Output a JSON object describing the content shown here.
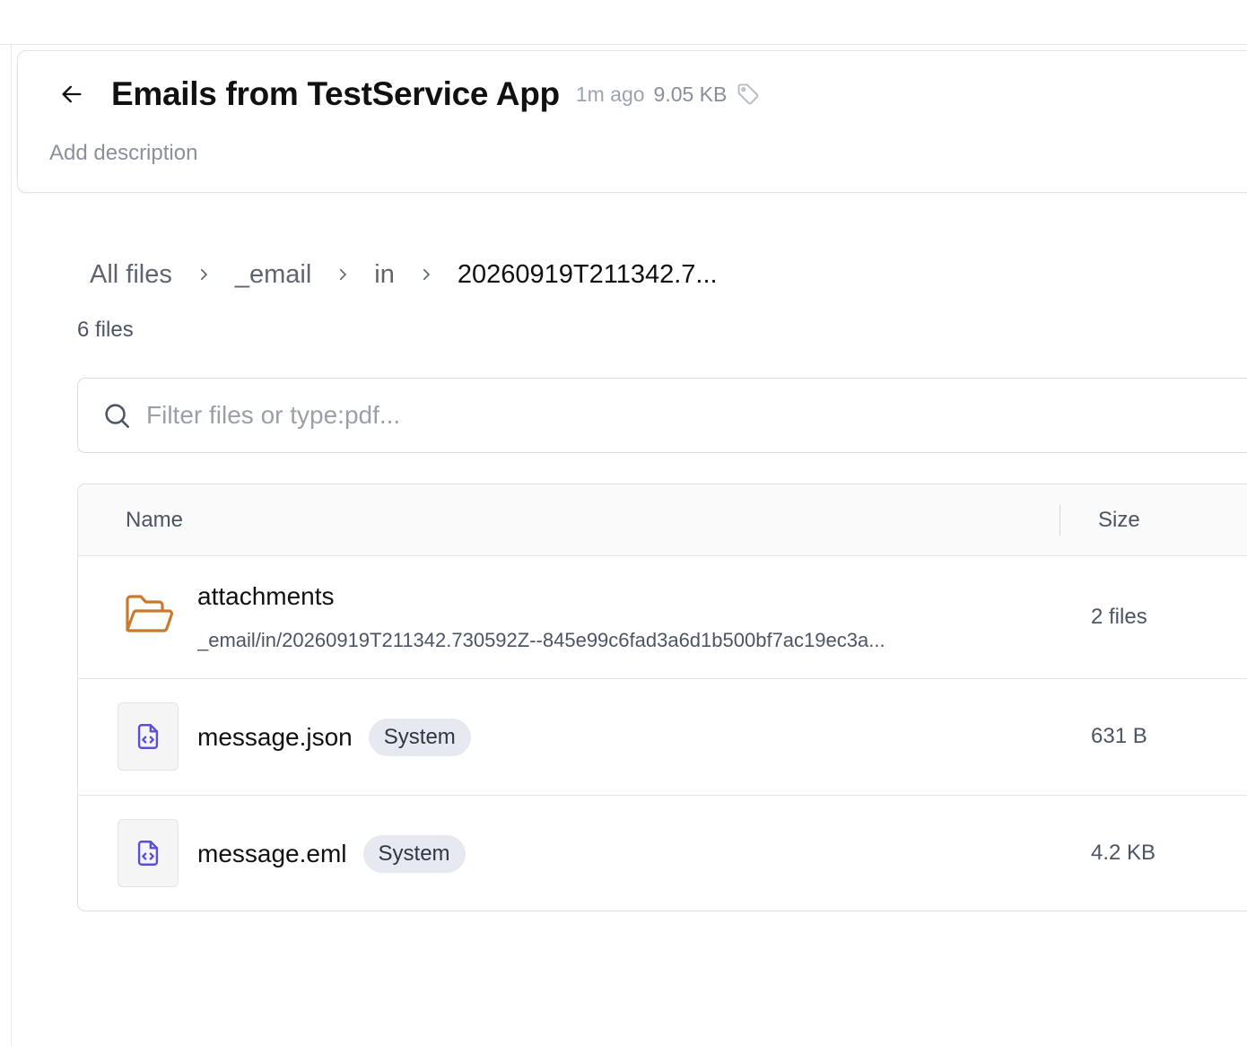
{
  "header": {
    "title": "Emails from TestService App",
    "updated": "1m ago",
    "size": "9.05 KB",
    "description_placeholder": "Add description"
  },
  "breadcrumb": [
    "All files",
    "_email",
    "in",
    "20260919T211342.7..."
  ],
  "file_count": "6 files",
  "search": {
    "placeholder": "Filter files or type:pdf..."
  },
  "table": {
    "columns": {
      "name": "Name",
      "size": "Size"
    },
    "rows": [
      {
        "type": "folder",
        "name": "attachments",
        "path": "_email/in/20260919T211342.730592Z--845e99c6fad3a6d1b500bf7ac19ec3a...",
        "size": "2 files"
      },
      {
        "type": "file",
        "name": "message.json",
        "badge": "System",
        "size": "631 B"
      },
      {
        "type": "file",
        "name": "message.eml",
        "badge": "System",
        "size": "4.2 KB"
      }
    ]
  },
  "icons": {
    "back": "arrow-left-icon",
    "tag": "tag-icon",
    "breadcrumb_separator": "chevron-right-icon",
    "search": "search-icon",
    "folder": "folder-open-icon",
    "file": "code-file-icon"
  },
  "colors": {
    "folder_icon": "#c97a2e",
    "file_icon": "#5b4fd9",
    "badge_bg": "#e6e9ef"
  }
}
